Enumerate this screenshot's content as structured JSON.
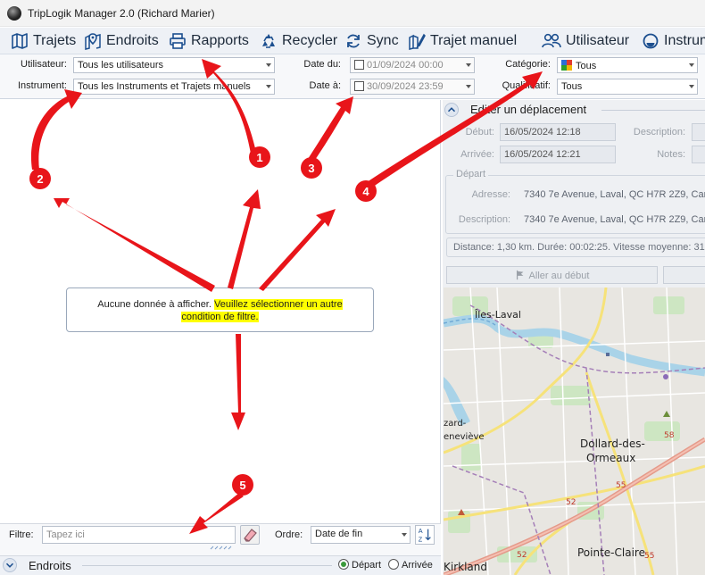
{
  "window": {
    "title": "TripLogik Manager 2.0 (Richard Marier)"
  },
  "toolbar": {
    "items": [
      {
        "label": "Trajets",
        "icon": "map-icon"
      },
      {
        "label": "Endroits",
        "icon": "map-pin-icon"
      },
      {
        "label": "Rapports",
        "icon": "printer-icon"
      },
      {
        "label": "Recycler",
        "icon": "recycle-icon"
      },
      {
        "label": "Sync",
        "icon": "sync-icon"
      },
      {
        "label": "Trajet manuel",
        "icon": "manual-trip-icon"
      },
      {
        "label": "Utilisateur",
        "icon": "users-icon"
      },
      {
        "label": "Instrum",
        "icon": "instrument-icon"
      }
    ]
  },
  "filters": {
    "user_label": "Utilisateur:",
    "user_value": "Tous les utilisateurs",
    "instrument_label": "Instrument:",
    "instrument_value": "Tous les Instruments et Trajets manuels",
    "date_from_label": "Date du:",
    "date_from_value": "01/09/2024 00:00",
    "date_to_label": "Date à:",
    "date_to_value": "30/09/2024 23:59",
    "category_label": "Catégorie:",
    "category_value": "Tous",
    "qualifier_label": "Qualificatif:",
    "qualifier_value": "Tous"
  },
  "main": {
    "no_data_prefix": "Aucune donnée à afficher. ",
    "no_data_highlight_1": "Veuillez sélectionner un autre",
    "no_data_highlight_2": "condition de filtre."
  },
  "bottom": {
    "filter_label": "Filtre:",
    "filter_placeholder": "Tapez ici",
    "order_label": "Ordre:",
    "order_value": "Date de fin"
  },
  "endroits": {
    "title": "Endroits",
    "radio_depart": "Départ",
    "radio_arrivee": "Arrivée",
    "selected": "Départ"
  },
  "edit": {
    "title": "Editer un déplacement",
    "debut_label": "Début:",
    "debut_value": "16/05/2024 12:18",
    "arrivee_label": "Arrivée:",
    "arrivee_value": "16/05/2024 12:21",
    "description_label": "Description:",
    "notes_label": "Notes:",
    "depart_group": "Départ",
    "adresse_label": "Adresse:",
    "adresse_value": "7340 7e Avenue, Laval, QC H7R 2Z9, Can",
    "desc2_label": "Description:",
    "desc2_value": "7340 7e Avenue, Laval, QC H7R 2Z9, Can",
    "summary": "Distance: 1,30 km. Durée: 00:02:25. Vitesse moyenne: 31",
    "goto_start": "Aller au début"
  },
  "map": {
    "labels": [
      "Îles-Laval",
      "Dollard-des-",
      "Ormeaux",
      "Pointe-Claire",
      "Kirkland",
      "zard-",
      "eneviève"
    ],
    "route_numbers": [
      "58",
      "55",
      "52",
      "52",
      "55"
    ]
  },
  "annotations": [
    "1",
    "2",
    "3",
    "4",
    "5"
  ],
  "colors": {
    "annotation_red": "#e8151a",
    "highlight": "#ffff00",
    "toolbar_icon": "#1c4f8f"
  }
}
